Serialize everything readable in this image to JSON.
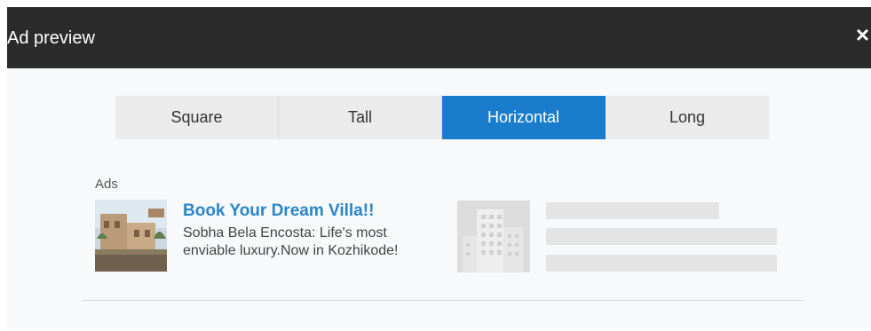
{
  "dialog": {
    "title": "Ad preview",
    "close_label": "×"
  },
  "tabs": [
    {
      "label": "Square",
      "active": false
    },
    {
      "label": "Tall",
      "active": false
    },
    {
      "label": "Horizontal",
      "active": true
    },
    {
      "label": "Long",
      "active": false
    }
  ],
  "ad": {
    "section_label": "Ads",
    "title": "Book Your Dream Villa!!",
    "description": "Sobha Bela Encosta: Life's most enviable luxury.Now in Kozhikode!",
    "thumbnail_icon": "villa-photo"
  },
  "placeholder": {
    "image_icon": "building-icon"
  },
  "colors": {
    "title_bar": "#2b2b2b",
    "active_tab": "#1a7ccd",
    "ad_title": "#2a86c9",
    "placeholder": "#e4e4e4"
  }
}
